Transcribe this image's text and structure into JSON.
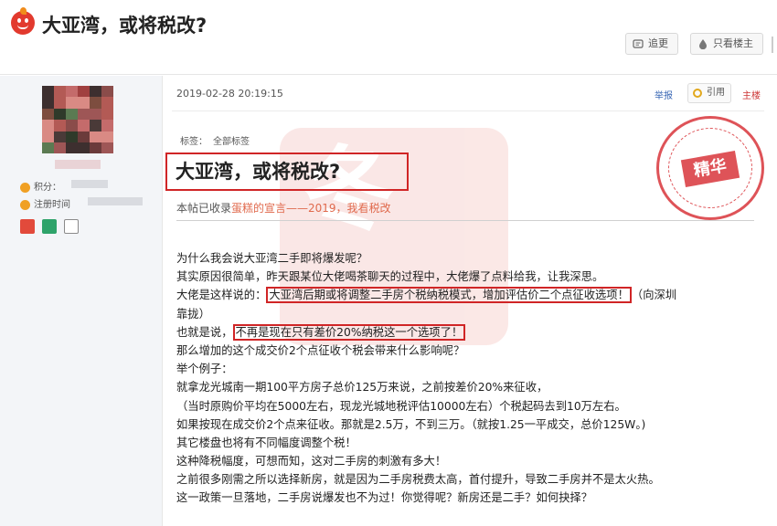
{
  "header": {
    "title": "大亚湾，或将税改?",
    "follow_label": "追更",
    "only_author_label": "只看楼主"
  },
  "sidebar": {
    "points_label": "积分：",
    "register_label": "注册时间"
  },
  "post": {
    "date": "2019-02-28 20:19:15",
    "report_label": "举报",
    "quote_label": "引用",
    "floor_label": "主楼",
    "tags_label": "标签：",
    "tags_value": "全部标签",
    "title": "大亚湾，或将税改?",
    "collected_prefix": "本帖已收录",
    "collected_link": "蛋糕的宣言——2019，我看税改",
    "stamp_label": "精华",
    "watermark_text": "冬",
    "lines": [
      "为什么我会说大亚湾二手即将爆发呢？",
      "其实原因很简单，昨天跟某位大佬喝茶聊天的过程中，大佬爆了点料给我，让我深思。",
      "大佬是这样说的：",
      "大亚湾后期或将调整二手房个税纳税模式，增加评估价二个点征收选项！",
      "（向深圳",
      "靠拢）",
      "也就是说，",
      "不再是现在只有差价20%纳税这一个选项了！",
      "那么增加的这个成交价2个点征收个税会带来什么影响呢？",
      "举个例子：",
      "就拿龙光城南一期100平方房子总价125万来说，之前按差价20%来征收，",
      "（当时原购价平均在5000左右，现龙光城地税评估10000左右）个税起码去到10万左右。",
      "如果按现在成交价2个点来征收。那就是2.5万，不到三万。（就按1.25一平成交，总价125W。)",
      "其它楼盘也将有不同幅度调整个税！",
      "这种降税幅度，可想而知，这对二手房的刺激有多大！",
      "之前很多刚需之所以选择新房，就是因为二手房税费太高，首付提升，导致二手房并不是太火热。",
      "这一政策一旦落地，二手房说爆发也不为过！你觉得呢？新房还是二手？如何抉择？"
    ]
  },
  "colors": {
    "accent_red": "#d02526",
    "link_blue": "#3a68b5",
    "link_orange": "#e06a4d",
    "sidebar_bg": "#f3f5f8"
  }
}
